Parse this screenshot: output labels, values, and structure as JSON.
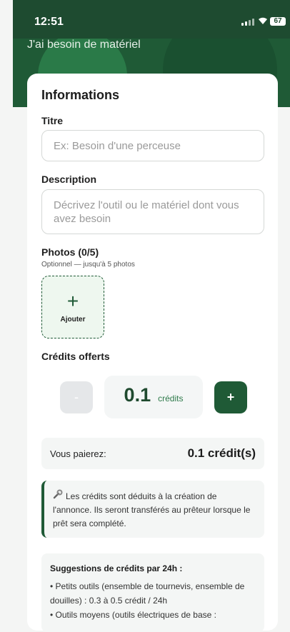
{
  "status": {
    "time": "12:51",
    "battery": "67"
  },
  "page": {
    "title": "J'ai besoin de matériel"
  },
  "form": {
    "section_title": "Informations",
    "title_label": "Titre",
    "title_placeholder": "Ex: Besoin d'une perceuse",
    "description_label": "Description",
    "description_placeholder": "Décrivez l'outil ou le matériel dont vous avez besoin",
    "photos_label": "Photos (0/5)",
    "photos_hint": "Optionnel — jusqu'à 5 photos",
    "photo_add_label": "Ajouter",
    "credits_label": "Crédits offerts",
    "minus_label": "-",
    "credit_value": "0.1",
    "credit_unit": "crédits",
    "plus_label": "+",
    "pay_label": "Vous paierez:",
    "pay_amount": "0.1 crédit(s)",
    "info_text": "Les crédits sont déduits à la création de l'annonce. Ils seront transférés au prêteur lorsque le prêt sera complété.",
    "suggestions_title": "Suggestions de crédits par 24h :",
    "suggestions": [
      "• Petits outils (ensemble de tournevis, ensemble de douilles) : 0.3 à 0.5 crédit / 24h",
      "• Outils moyens (outils électriques de base :"
    ]
  },
  "colors": {
    "primary": "#1f5a36",
    "header": "#1e4b30"
  },
  "icons": {
    "signal": "signal-icon",
    "wifi": "wifi-icon",
    "battery": "battery-icon",
    "wrench": "wrench-icon"
  }
}
